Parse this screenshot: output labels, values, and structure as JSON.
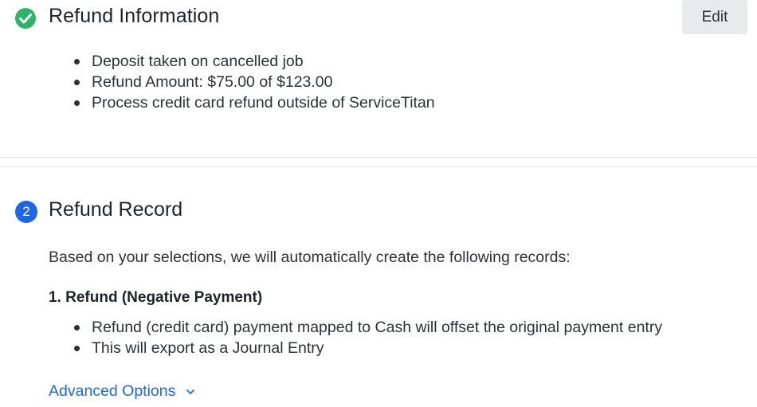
{
  "refund_information": {
    "title": "Refund Information",
    "status_icon": "check-circle-icon",
    "edit_label": "Edit",
    "items": [
      "Deposit taken on cancelled job",
      "Refund Amount: $75.00 of $123.00",
      "Process credit card refund outside of ServiceTitan"
    ]
  },
  "refund_record": {
    "step_number": "2",
    "title": "Refund Record",
    "description": "Based on your selections, we will automatically create the following records:",
    "record_title": "1. Refund (Negative Payment)",
    "items": [
      "Refund (credit card) payment mapped to Cash will offset the original payment entry",
      "This will export as a Journal Entry"
    ],
    "advanced_options_label": "Advanced Options",
    "advanced_options_icon": "chevron-down-icon"
  },
  "colors": {
    "success_green": "#2fb36a",
    "step_blue": "#1e66e8",
    "link_blue": "#1e66e8",
    "edit_button_bg": "#e9eaeb"
  }
}
